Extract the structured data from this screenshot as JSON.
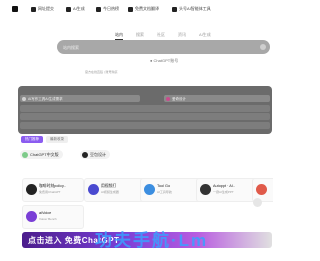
{
  "nav": {
    "items": [
      {
        "label": "网址提交",
        "icon": "submit-icon"
      },
      {
        "label": "AI生成",
        "icon": "ai-icon"
      },
      {
        "label": "今日热榜",
        "icon": "hot-icon"
      },
      {
        "label": "免费文档翻译",
        "icon": "translate-icon"
      },
      {
        "label": "头号AI智能体工具",
        "icon": "agent-icon"
      }
    ]
  },
  "search": {
    "tabs": [
      "站内",
      "搜索",
      "社区",
      "资讯",
      "AI生成"
    ],
    "active_tab": "站内",
    "placeholder": "站内搜索",
    "hint_label": "ChatGPT账号",
    "sub_hint": "官方在线直链 | 账号购买"
  },
  "panel": {
    "rows": [
      {
        "label": "AI写作工具AI生成需求"
      },
      {
        "label": "爱奇设计"
      }
    ],
    "tags": [
      "热门推荐",
      "最新收录"
    ]
  },
  "pills": [
    {
      "label": "ChatGPT中文版",
      "color": "#7ecb8a"
    },
    {
      "label": "豆包设计",
      "color": "#222222"
    }
  ],
  "cards": [
    {
      "name": "咖啡时刻policy..",
      "sub": "免费用ChatGPT",
      "color": "#222222"
    },
    {
      "name": "用视频打",
      "sub": "AI视频生成器",
      "color": "#4a4ad0"
    },
    {
      "name": "Tool Go",
      "sub": "AI工具导航",
      "color": "#3c8ee0"
    },
    {
      "name": "Autoppt · AI..",
      "sub": "一键AI生成PPT",
      "color": "#333333"
    },
    {
      "name": "AI",
      "sub": "AI",
      "color": "#e05a4a"
    },
    {
      "name": "aiVoice",
      "sub": "Voicer Bench",
      "color": "#7a3fd6"
    }
  ],
  "banner": {
    "label": "点击进入 免费ChatGPT"
  },
  "watermark": "功夫手航·Lm"
}
